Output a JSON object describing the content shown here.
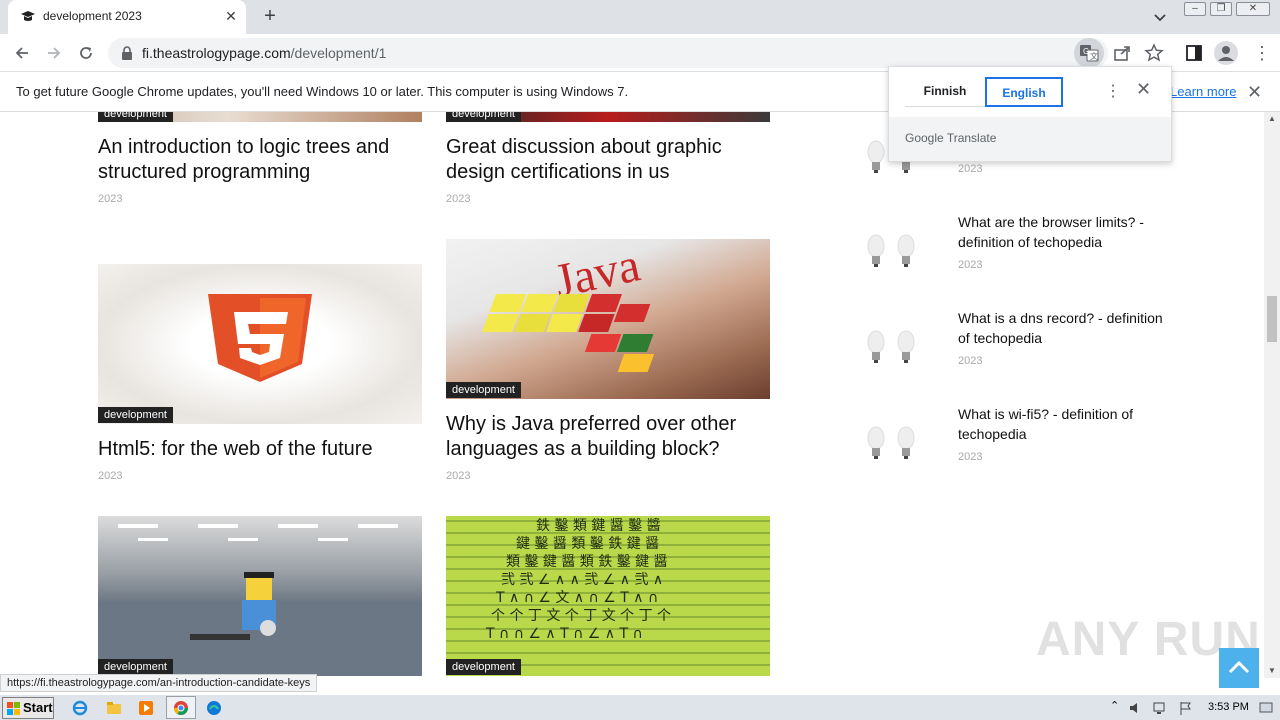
{
  "browser": {
    "tab_title": "development 2023",
    "url_host": "fi.theastrologypage.com",
    "url_path": "/development/1",
    "status_url": "https://fi.theastrologypage.com/an-introduction-candidate-keys"
  },
  "infobar": {
    "message": "To get future Google Chrome updates, you'll need Windows 10 or later. This computer is using Windows 7.",
    "learn_more": "Learn more"
  },
  "translate": {
    "source_lang": "Finnish",
    "target_lang": "English",
    "brand": "Google Translate"
  },
  "posts": [
    {
      "category": "development",
      "title": "An introduction to logic trees and structured programming",
      "year": "2023"
    },
    {
      "category": "development",
      "title": "Great discussion about graphic design certifications in us",
      "year": "2023"
    },
    {
      "category": "development",
      "title": "Html5: for the web of the future",
      "year": "2023"
    },
    {
      "category": "development",
      "title": "Why is Java preferred over other languages as a building block?",
      "year": "2023"
    },
    {
      "category": "development",
      "title": "",
      "year": ""
    },
    {
      "category": "development",
      "title": "",
      "year": ""
    }
  ],
  "sidebar": [
    {
      "title": "",
      "year": "2023"
    },
    {
      "title": "What are the browser limits? - definition of techopedia",
      "year": "2023"
    },
    {
      "title": "What is a dns record? - definition of techopedia",
      "year": "2023"
    },
    {
      "title": "What is wi-fi5? - definition of techopedia",
      "year": "2023"
    }
  ],
  "watermark": "ANY RUN",
  "taskbar": {
    "start": "Start",
    "clock": "3:53 PM"
  }
}
